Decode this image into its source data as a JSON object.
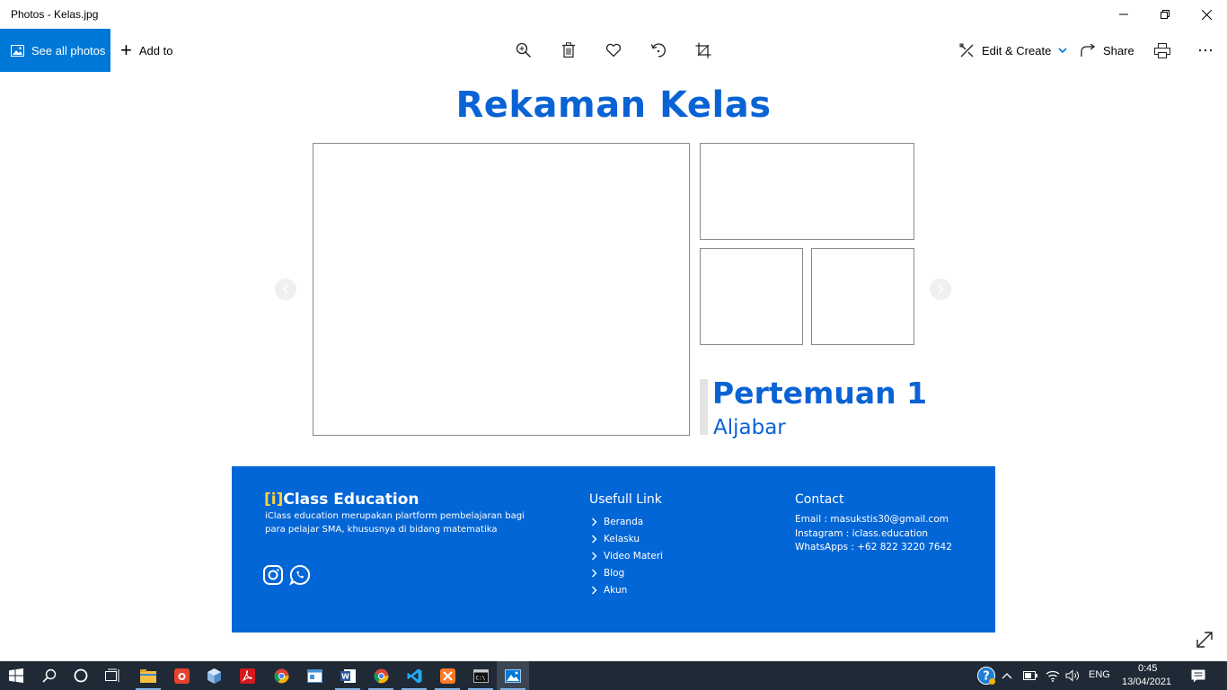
{
  "window": {
    "title": "Photos - Kelas.jpg"
  },
  "toolbar": {
    "see_all_photos": "See all photos",
    "add_to": "Add to",
    "edit_create": "Edit & Create",
    "share": "Share"
  },
  "slide": {
    "headline": "Rekaman Kelas",
    "meeting_title": "Pertemuan 1",
    "meeting_subtitle": "Aljabar"
  },
  "footer": {
    "brand_mark": "[i]",
    "brand_name": "Class Education",
    "description": "iClass education merupakan plartform pembelajaran bagi para pelajar SMA, khususnya di bidang matematika",
    "links_title": "Usefull Link",
    "links": [
      {
        "label": "Beranda"
      },
      {
        "label": "Kelasku"
      },
      {
        "label": "Video Materi"
      },
      {
        "label": "Blog"
      },
      {
        "label": "Akun"
      }
    ],
    "contact_title": "Contact",
    "contact": {
      "email": "Email : masukstis30@gmail.com",
      "instagram": "Instagram : iclass.education",
      "whatsapp": "WhatsApps : +62 822 3220 7642"
    }
  },
  "taskbar": {
    "language": "ENG",
    "time": "0:45",
    "date": "13/04/2021"
  },
  "colors": {
    "accent": "#0078d7",
    "slide_blue": "#0a63d4",
    "footer_blue": "#0366d6",
    "brand_yellow": "#ffd33a",
    "taskbar": "#1f2a36"
  }
}
